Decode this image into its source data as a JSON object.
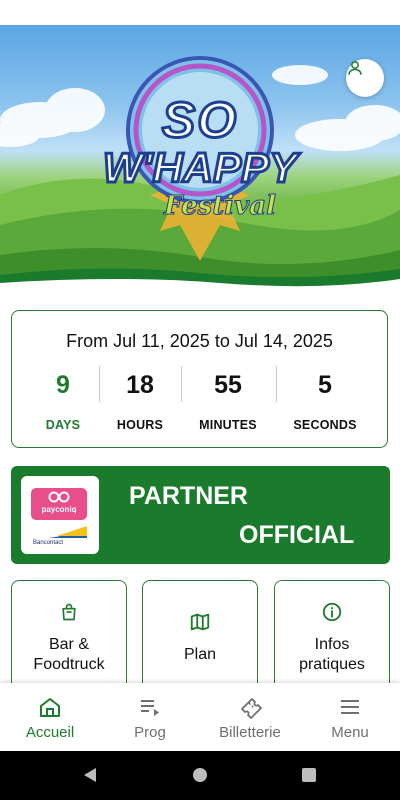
{
  "hero": {
    "logo_line1": "SO",
    "logo_line2": "W'HAPPY",
    "logo_line3": "Festival"
  },
  "countdown": {
    "date_range": "From Jul 11, 2025 to Jul 14, 2025",
    "units": [
      {
        "value": "9",
        "label": "DAYS"
      },
      {
        "value": "18",
        "label": "HOURS"
      },
      {
        "value": "55",
        "label": "MINUTES"
      },
      {
        "value": "5",
        "label": "SECONDS"
      }
    ]
  },
  "partner": {
    "line1": "PARTNER",
    "line2": "OFFICIAL",
    "logo_brand": "payconiq",
    "logo_sub": "Bancontact"
  },
  "tiles": [
    {
      "label_line1": "Bar &",
      "label_line2": "Foodtruck",
      "icon": "shopping-bag-icon"
    },
    {
      "label_line1": "Plan",
      "label_line2": "",
      "icon": "map-icon"
    },
    {
      "label_line1": "Infos",
      "label_line2": "pratiques",
      "icon": "info-icon"
    }
  ],
  "nav": [
    {
      "label": "Accueil",
      "icon": "home-icon",
      "active": true
    },
    {
      "label": "Prog",
      "icon": "playlist-icon",
      "active": false
    },
    {
      "label": "Billetterie",
      "icon": "ticket-icon",
      "active": false
    },
    {
      "label": "Menu",
      "icon": "hamburger-icon",
      "active": false
    }
  ],
  "colors": {
    "primary_green": "#1b7b2c",
    "border_green": "#2a7a34",
    "payconiq_pink": "#e84e8a",
    "nav_inactive": "#6f6f6f"
  }
}
